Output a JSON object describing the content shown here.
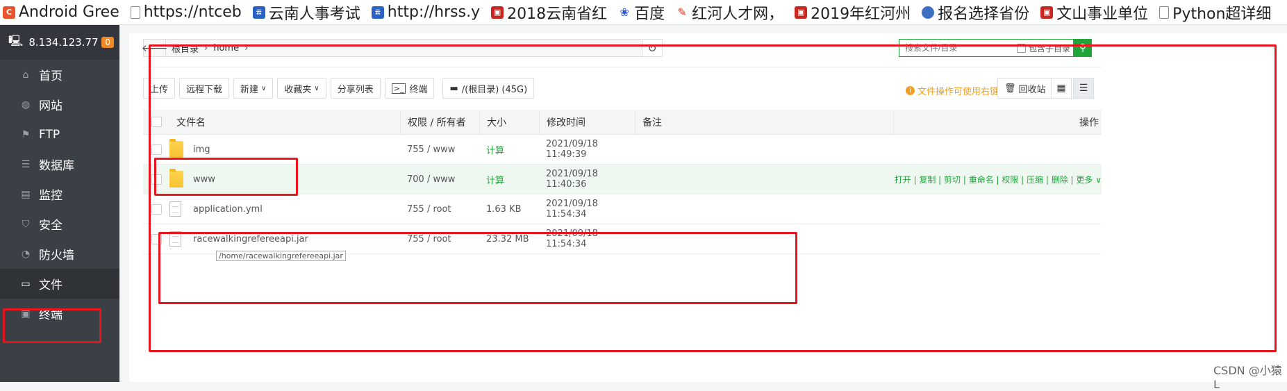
{
  "bookmarks": [
    {
      "icon": "c-logo-icon",
      "label": "Android Gree"
    },
    {
      "icon": "page-icon",
      "label": "https://ntceb"
    },
    {
      "icon": "yunnan-hr-icon",
      "label": "云南人事考试"
    },
    {
      "icon": "yunnan-hr-icon",
      "label": "http://hrss.y"
    },
    {
      "icon": "red-icon",
      "label": "2018云南省红"
    },
    {
      "icon": "baidu-paw-icon",
      "label": "百度"
    },
    {
      "icon": "honghe-icon",
      "label": "红河人才网，"
    },
    {
      "icon": "red-icon",
      "label": "2019年红河州"
    },
    {
      "icon": "globe-icon",
      "label": "报名选择省份"
    },
    {
      "icon": "red-icon",
      "label": "文山事业单位"
    },
    {
      "icon": "page-icon",
      "label": "Python超详细"
    }
  ],
  "sidebar": {
    "server_ip": "8.134.123.77",
    "badge": "0",
    "items": [
      {
        "icon": "home-icon",
        "label": "首页"
      },
      {
        "icon": "globe-icon",
        "label": "网站"
      },
      {
        "icon": "ftp-icon",
        "label": "FTP"
      },
      {
        "icon": "database-icon",
        "label": "数据库"
      },
      {
        "icon": "monitor-icon",
        "label": "监控"
      },
      {
        "icon": "shield-icon",
        "label": "安全"
      },
      {
        "icon": "firewall-icon",
        "label": "防火墙"
      },
      {
        "icon": "folder-icon",
        "label": "文件"
      },
      {
        "icon": "terminal-icon",
        "label": "终端"
      }
    ],
    "active_index": 7
  },
  "pathbar": {
    "crumbs": [
      "根目录",
      "home"
    ]
  },
  "search": {
    "placeholder": "搜索文件/目录",
    "subdir_label": "包含子目录"
  },
  "toolbar": {
    "upload": "上传",
    "remote_download": "远程下载",
    "new": "新建",
    "favorites": "收藏夹",
    "share_list": "分享列表",
    "terminal": "终端",
    "disk": "/(根目录) (45G)",
    "tip": "文件操作可使用右键",
    "recycle": "回收站"
  },
  "table": {
    "headers": {
      "name": "文件名",
      "perm": "权限 / 所有者",
      "size": "大小",
      "time": "修改时间",
      "note": "备注",
      "ops": "操作"
    },
    "rows": [
      {
        "type": "folder",
        "name": "img",
        "perm": "755 / www",
        "size": "计算",
        "time": "2021/09/18 11:49:39"
      },
      {
        "type": "folder",
        "name": "www",
        "perm": "700 / www",
        "size": "计算",
        "time": "2021/09/18 11:40:36"
      },
      {
        "type": "file",
        "name": "application.yml",
        "perm": "755 / root",
        "size": "1.63 KB",
        "time": "2021/09/18 11:54:34"
      },
      {
        "type": "file",
        "name": "racewalkingrefereeapi.jar",
        "perm": "755 / root",
        "size": "23.32 MB",
        "time": "2021/09/18 11:54:34"
      }
    ],
    "row_ops": "打开 | 复制 | 剪切 | 重命名 | 权限 | 压缩 | 删除 | 更多"
  },
  "tooltip": "/home/racewalkingrefereeapi.jar",
  "watermark": "CSDN @小猿L",
  "colors": {
    "accent": "#20a53a",
    "annotation": "#e8141e",
    "sidebar_bg": "#3b3f46",
    "tip": "#f0a020"
  }
}
